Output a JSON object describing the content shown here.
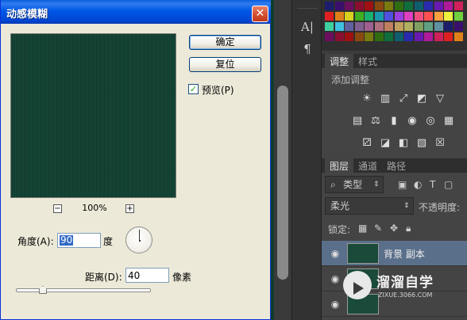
{
  "dialog": {
    "title": "动感模糊",
    "close_glyph": "✕",
    "ok_label": "确定",
    "reset_label": "复位",
    "preview_checkbox_label": "预览(P)",
    "preview_checked": true,
    "zoom_out_glyph": "−",
    "zoom_in_glyph": "+",
    "zoom_level": "100%",
    "angle_label": "角度(A):",
    "angle_value": "90",
    "angle_unit": "度",
    "distance_label": "距离(D):",
    "distance_value": "40",
    "distance_unit": "像素",
    "distance_slider_fraction": 0.2
  },
  "toolstrip": {
    "type_tool_glyph": "A|",
    "paragraph_glyph": "¶"
  },
  "adjustments_panel": {
    "tabs": [
      "调整",
      "样式"
    ],
    "title": "添加调整",
    "icons": [
      "brightness-icon",
      "levels-icon",
      "curves-icon",
      "exposure-icon",
      "vibrance-icon",
      "hue-saturation-icon",
      "color-balance-icon",
      "black-white-icon",
      "photo-filter-icon",
      "channel-mixer-icon",
      "color-lookup-icon",
      "invert-icon",
      "posterize-icon",
      "threshold-icon",
      "gradient-map-icon",
      "selective-color-icon"
    ]
  },
  "layers_panel": {
    "tabs": [
      "图层",
      "通道",
      "路径"
    ],
    "filter_label": "类型",
    "blend_mode": "柔光",
    "opacity_label": "不透明度:",
    "lock_label": "锁定:",
    "layers": [
      {
        "name": "背景 副本",
        "selected": true
      },
      {
        "name": "",
        "selected": false
      },
      {
        "name": "",
        "selected": false
      }
    ]
  },
  "watermark": {
    "title": "溜溜自学",
    "subtitle": "ZIXUE.3066.COM"
  },
  "colors": {
    "xp_title_blue": "#0054e3",
    "dialog_face": "#ece9d8",
    "canvas_green": "#0f3a2c",
    "selected_layer": "#5a6f89"
  }
}
